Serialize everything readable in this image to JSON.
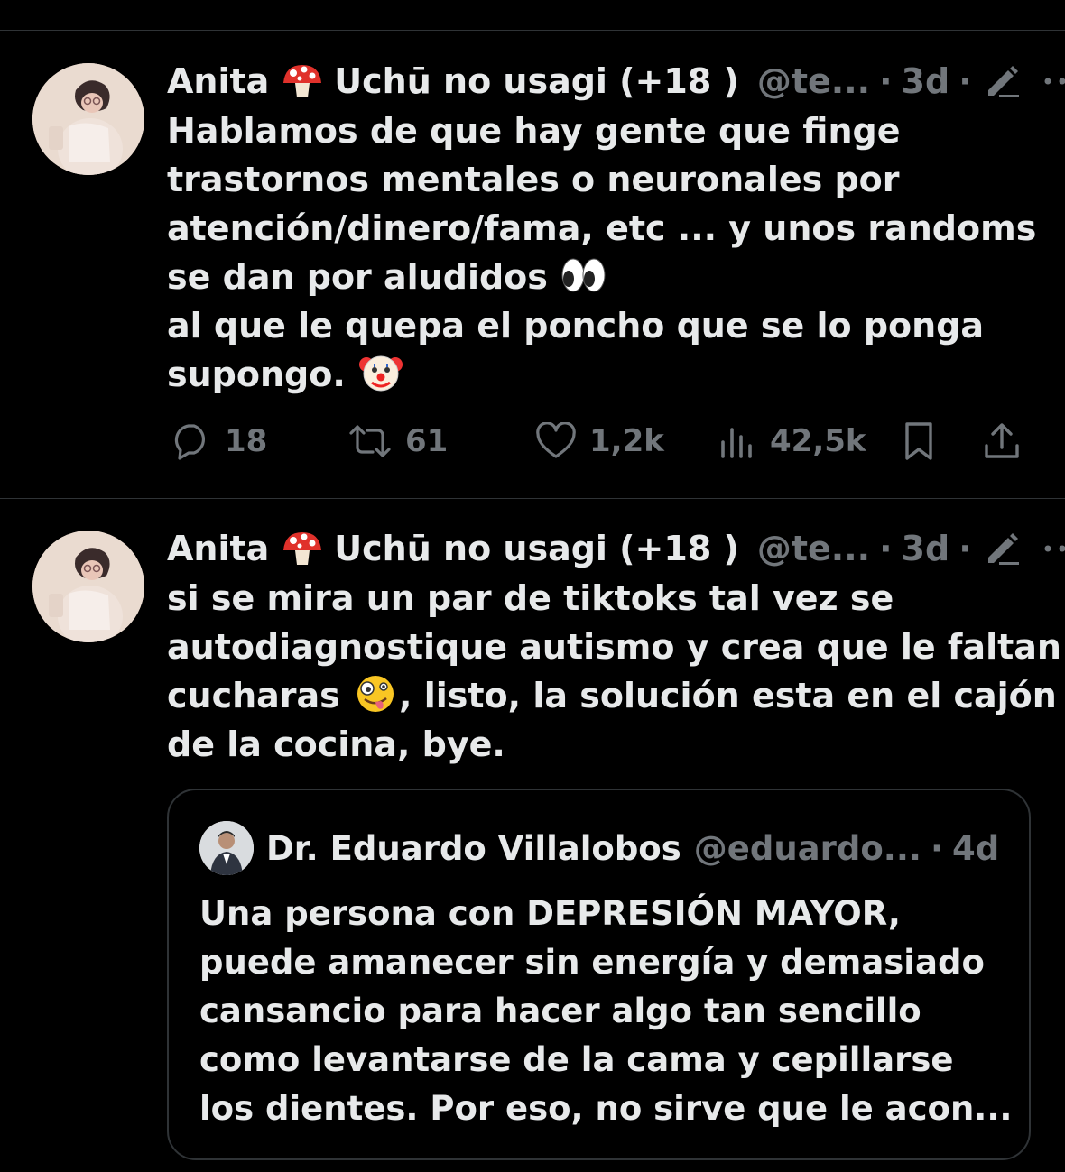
{
  "tweets": [
    {
      "display_name": "Anita",
      "name_suffix": "Uchū no usagi (+18 )",
      "handle": "@te...",
      "separator": "·",
      "time": "3d",
      "text_lines": [
        "Hablamos de que hay gente que finge",
        "trastornos mentales o neuronales por",
        "atención/dinero/fama, etc ... y unos randoms",
        "se dan por aludidos",
        "al que le quepa el poncho que se lo ponga",
        "supongo."
      ],
      "stats": {
        "replies": "18",
        "retweets": "61",
        "likes": "1,2k",
        "views": "42,5k"
      }
    },
    {
      "display_name": "Anita",
      "name_suffix": "Uchū no usagi (+18 )",
      "handle": "@te...",
      "separator": "·",
      "time": "3d",
      "text_lines": [
        "si se mira un par de tiktoks tal vez se",
        "autodiagnostique autismo y crea que le faltan",
        "cucharas",
        ", listo, la solución esta en el cajón",
        "de la cocina, bye."
      ],
      "quote": {
        "name": "Dr. Eduardo Villalobos",
        "handle": "@eduardo...",
        "separator": "·",
        "time": "4d",
        "text_lines": [
          "Una persona con DEPRESIÓN MAYOR,",
          "puede amanecer sin energía y demasiado",
          "cansancio para hacer algo tan sencillo",
          "como levantarse de la cama y cepillarse",
          "los dientes. Por eso, no sirve que le acon..."
        ]
      }
    }
  ],
  "icons": {
    "name_emoji": "mushroom-icon",
    "edit": "edit-pencil-icon",
    "more": "more-dots-icon",
    "reply": "reply-bubble-icon",
    "retweet": "retweet-icon",
    "like": "heart-icon",
    "views": "views-bar-icon",
    "bookmark": "bookmark-icon",
    "share": "share-icon",
    "emoji_eyes": "eyes-emoji",
    "emoji_clown": "clown-emoji",
    "emoji_zany": "zany-face-emoji"
  },
  "colors": {
    "background": "#000000",
    "text": "#e7e9ea",
    "muted": "#71767b",
    "divider": "#2f3336"
  }
}
